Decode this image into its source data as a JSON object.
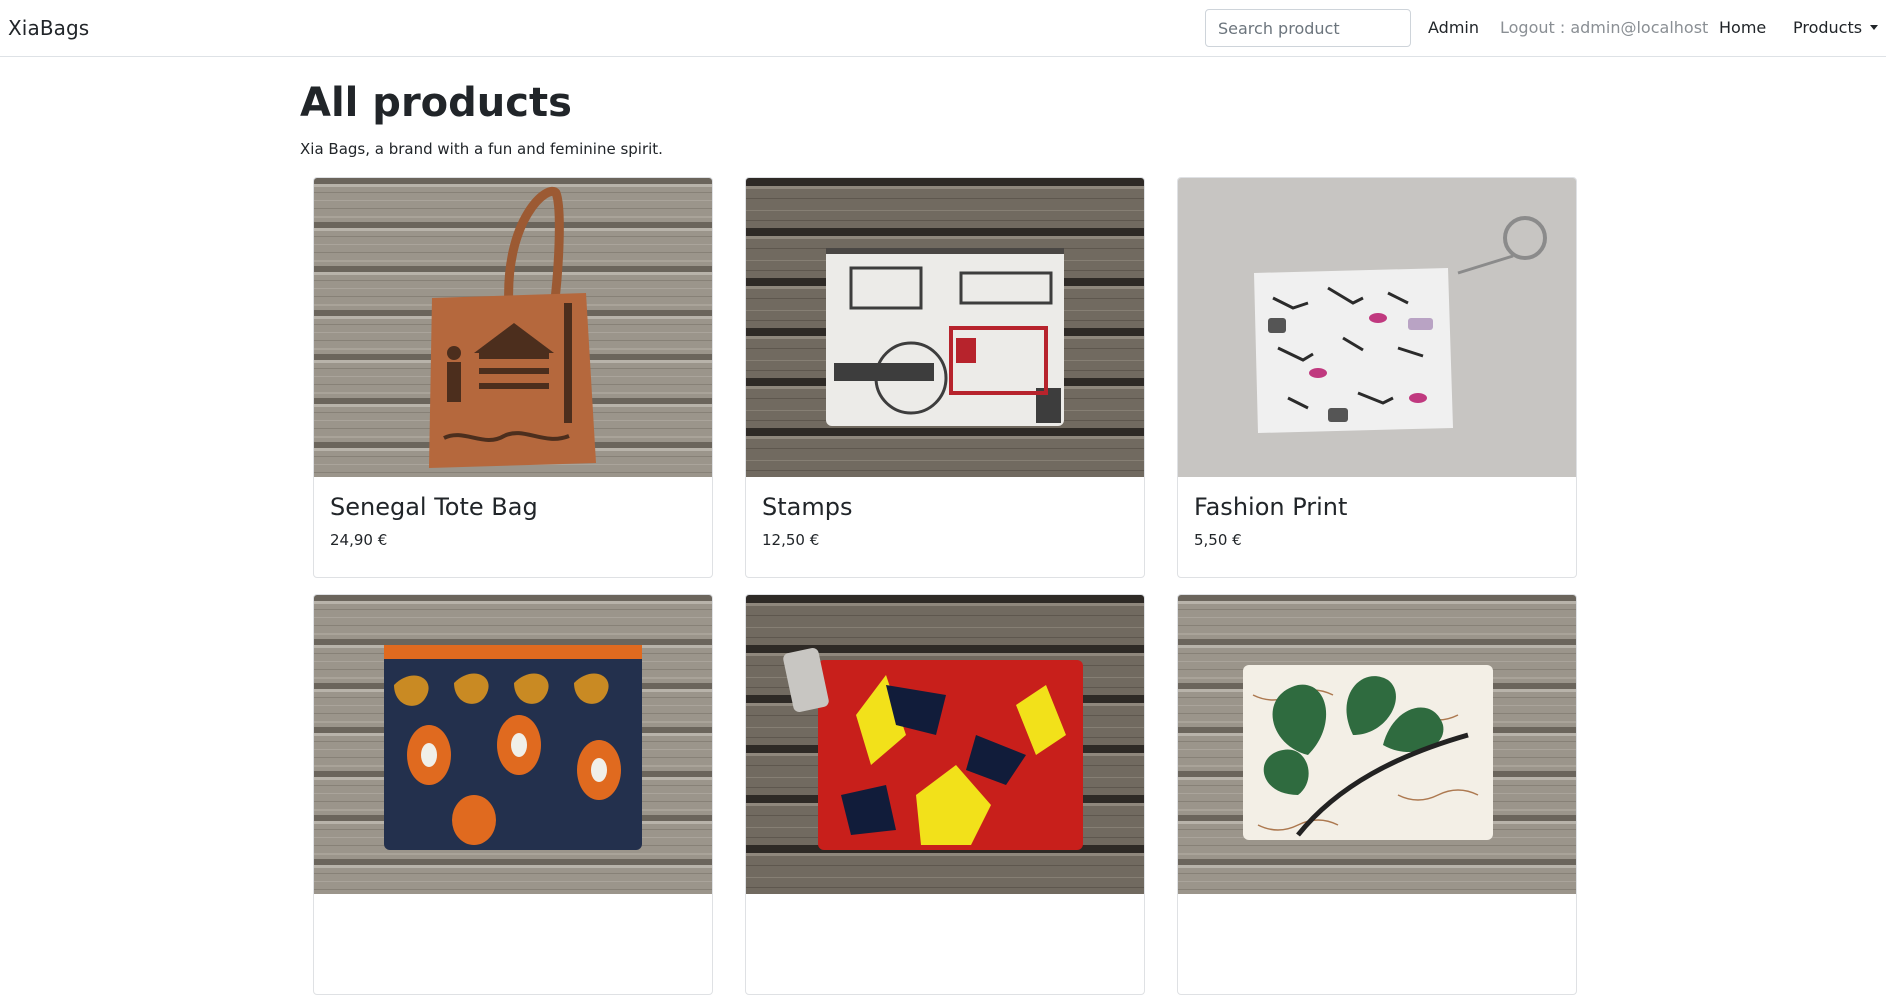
{
  "navbar": {
    "brand": "XiaBags",
    "search_placeholder": "Search product",
    "admin_label": "Admin",
    "logout_label": "Logout : admin@localhost",
    "home_label": "Home",
    "products_label": "Products"
  },
  "page": {
    "title": "All products",
    "subtitle": "Xia Bags, a brand with a fun and feminine spirit."
  },
  "products": [
    {
      "name": "Senegal Tote Bag",
      "price": "24,90 €"
    },
    {
      "name": "Stamps",
      "price": "12,50 €"
    },
    {
      "name": "Fashion Print",
      "price": "5,50 €"
    },
    {
      "name": "",
      "price": ""
    },
    {
      "name": "",
      "price": ""
    },
    {
      "name": "",
      "price": ""
    }
  ],
  "colors": {
    "wood_light": "#a39d93",
    "wood_dark": "#5e5850",
    "tote": "#b5683d",
    "stamps_bg": "#ecebe8",
    "fashion_bg": "#c7c5c2",
    "paisley_navy": "#23304d",
    "wax_red": "#c81f1b",
    "wax_yellow": "#f2e11a",
    "leaf_green": "#2f6b3f"
  }
}
